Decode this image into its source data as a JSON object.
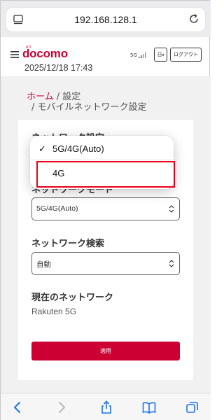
{
  "browser": {
    "url": "192.168.128.1"
  },
  "header": {
    "logo_small": "NTT",
    "logo": "docomo",
    "datetime": "2025/12/18 17:43",
    "signal_label": "5G",
    "language_label": "日",
    "logout_label": "ログアウト"
  },
  "breadcrumb": {
    "home": "ホーム",
    "sep": " / ",
    "settings": "設定",
    "line2": "/ モバイルネットワーク設定"
  },
  "form": {
    "network_setting_title": "ネットワーク設定",
    "network_mode_title": "ネットワークモード",
    "network_mode_value": "5G/4G(Auto)",
    "network_search_title": "ネットワーク検索",
    "network_search_value": "自動",
    "current_network_title": "現在のネットワーク",
    "current_network_value": "Rakuten 5G",
    "apply_label": "適用"
  },
  "dropdown": {
    "options": [
      {
        "label": "5G/4G(Auto)",
        "checked": true
      },
      {
        "label": "4G",
        "checked": false
      }
    ],
    "check_mark": "✓"
  },
  "colors": {
    "brand": "#cc0033",
    "highlight": "#e8001c",
    "browser_accent": "#1a73e8"
  }
}
